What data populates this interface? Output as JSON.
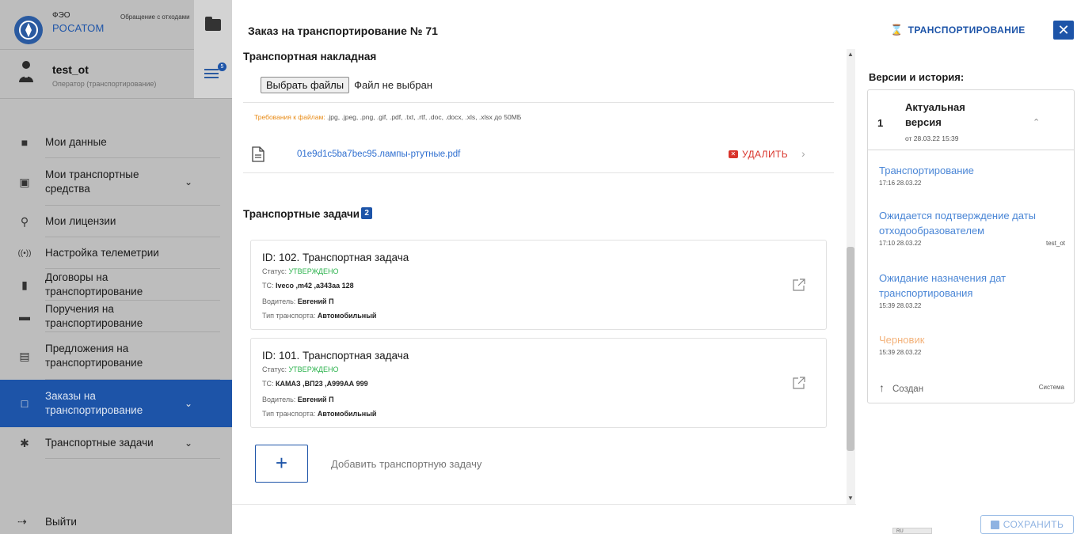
{
  "sidebar": {
    "brand_small": "ФЭО",
    "brand_big": "РОСАТОМ",
    "brand_desc": "Обращение с отходами I и II классов опасности",
    "user_name": "test_ot",
    "user_role": "Оператор (транспортирование)",
    "tasks_badge": "5",
    "items": [
      {
        "label": "Мои данные",
        "icon": "folder-icon"
      },
      {
        "label": "Мои транспортные средства",
        "icon": "bus-icon",
        "chevron": "⌄"
      },
      {
        "label": "Мои лицензии",
        "icon": "award-icon"
      },
      {
        "label": "Настройка телеметрии",
        "icon": "signal-icon"
      },
      {
        "label": "Договоры на транспортирование",
        "icon": "file-icon"
      },
      {
        "label": "Поручения на транспортирование",
        "icon": "folder-icon"
      },
      {
        "label": "Предложения на транспортирование",
        "icon": "document-icon"
      },
      {
        "label": "Заказы на транспортирование",
        "icon": "order-icon",
        "chevron": "⌄"
      },
      {
        "label": "Транспортные задачи",
        "icon": "puzzle-icon",
        "chevron": "⌄"
      }
    ],
    "logout_label": "Выйти"
  },
  "header": {
    "title": "Заказ на транспортирование № 71",
    "status": "ТРАНСПОРТИРОВАНИЕ",
    "close": "✕"
  },
  "invoice": {
    "title": "Транспортная накладная",
    "choose_button": "Выбрать файлы",
    "no_file": "Файл не выбран",
    "requirements_label": "Требования к файлам:",
    "requirements_types": ".jpg, .jpeg, .png, .gif, .pdf, .txt, .rtf, .doc, .docx, .xls, .xlsx до 50МБ",
    "file_name": "01e9d1c5ba7bec95.лампы-ртутные.pdf",
    "delete_label": "УДАЛИТЬ"
  },
  "tasks": {
    "title": "Транспортные задачи",
    "count": "2",
    "items": [
      {
        "title": "ID: 102. Транспортная задача",
        "status_label": "Статус:",
        "status": "УТВЕРЖДЕНО",
        "vehicle_label": "ТС:",
        "vehicle": "Iveco ,m42 ,a343aa 128",
        "driver_label": "Водитель:",
        "driver": "Евгений П",
        "type_label": "Тип транспорта:",
        "type": "Автомобильный"
      },
      {
        "title": "ID: 101. Транспортная задача",
        "status_label": "Статус:",
        "status": "УТВЕРЖДЕНО",
        "vehicle_label": "ТС:",
        "vehicle": "КАМАЗ ,ВП23 ,А999АА 999",
        "driver_label": "Водитель:",
        "driver": "Евгений П",
        "type_label": "Тип транспорта:",
        "type": "Автомобильный"
      }
    ],
    "add_label": "Добавить транспортную задачу"
  },
  "history": {
    "title": "Версии и история:",
    "current_num": "1",
    "current_label": "Актуальная версия",
    "current_date": "от 28.03.22 15:39",
    "entries": [
      {
        "title": "Транспортирование",
        "meta": "17:16 28.03.22",
        "user": ""
      },
      {
        "title": "Ожидается подтверждение даты отходообразователем",
        "meta": "17:10 28.03.22",
        "user": "test_ot"
      },
      {
        "title": "Ожидание назначения дат транспортирования",
        "meta": "15:39 28.03.22",
        "user": ""
      },
      {
        "title": "Черновик",
        "meta": "15:39 28.03.22",
        "user": ""
      }
    ],
    "created_label": "Создан",
    "created_by": "Система"
  },
  "footer": {
    "save_label": "СОХРАНИТЬ",
    "lang": "RU"
  },
  "colors": {
    "accent": "#1d54a8",
    "sidebar_bg": "#bdbdbd",
    "approved": "#2bb24c",
    "delete": "#d9342b",
    "draft": "#f3b27a",
    "requirements": "#e88a14"
  }
}
